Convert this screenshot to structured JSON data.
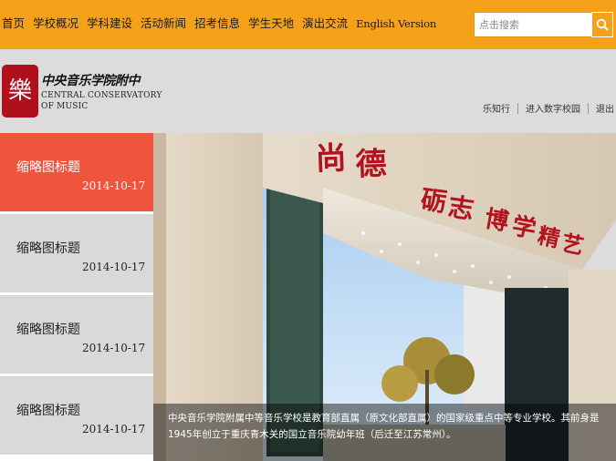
{
  "nav": {
    "items": [
      "首页",
      "学校概况",
      "学科建设",
      "活动新闻",
      "招考信息",
      "学生天地",
      "演出交流",
      "English Version"
    ]
  },
  "search": {
    "placeholder": "点击搜索",
    "icon": "search-icon"
  },
  "header": {
    "school_name_cn": "中央音乐学院附中",
    "school_name_en_line1": "CENTRAL CONSERVATORY",
    "school_name_en_line2": "OF MUSIC",
    "logo_glyph": "樂",
    "links": [
      "乐知行",
      "进入数字校园",
      "退出"
    ]
  },
  "thumbnails": [
    {
      "title": "缩略图标题",
      "date": "2014-10-17",
      "active": true
    },
    {
      "title": "缩略图标题",
      "date": "2014-10-17",
      "active": false
    },
    {
      "title": "缩略图标题",
      "date": "2014-10-17",
      "active": false
    },
    {
      "title": "缩略图标题",
      "date": "2014-10-17",
      "active": false
    }
  ],
  "slide": {
    "caption": "中央音乐学院附属中等音乐学校是教育部直属（原文化部直属）的国家级重点中等专业学校。其前身是1945年创立于重庆青木关的国立音乐院幼年班（后迁至江苏常州）。",
    "gate_inscription": "尚德 砺志 博学 精艺"
  },
  "colors": {
    "nav_bar": "#f6a11a",
    "header_band": "#dcdcdc",
    "active_item": "#f0543c",
    "inactive_item": "#d9d9d9",
    "logo_red": "#b0101c"
  }
}
